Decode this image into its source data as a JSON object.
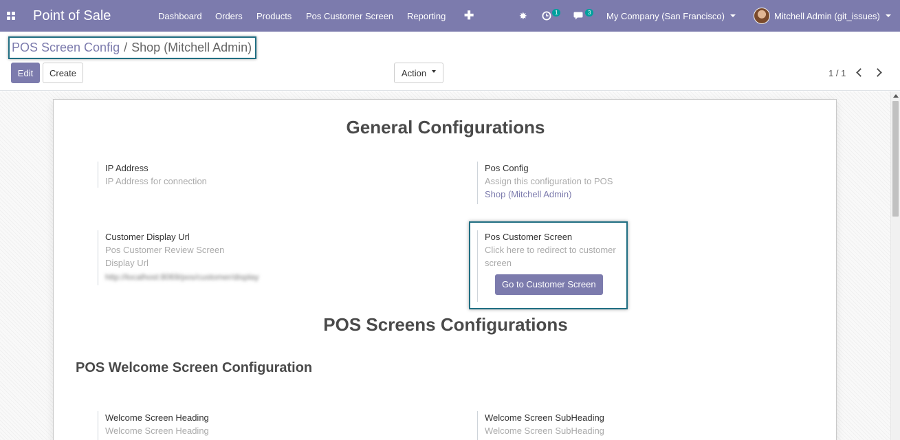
{
  "navbar": {
    "app_title": "Point of Sale",
    "menu": [
      "Dashboard",
      "Orders",
      "Products",
      "Pos Customer Screen",
      "Reporting"
    ],
    "plus_glyph": "✚",
    "bug_glyph": "✸",
    "activity_count": "1",
    "messages_count": "3",
    "company": "My Company (San Francisco)",
    "user": "Mitchell Admin (git_issues)"
  },
  "breadcrumb": {
    "parent": "POS Screen Config",
    "separator": "/",
    "current": "Shop (Mitchell Admin)"
  },
  "toolbar": {
    "edit_label": "Edit",
    "create_label": "Create",
    "action_label": "Action",
    "pager": "1 / 1"
  },
  "form": {
    "general_title": "General Configurations",
    "ip": {
      "label": "IP Address",
      "help": "IP Address for connection"
    },
    "pos_config": {
      "label": "Pos Config",
      "help": "Assign this configuration to POS",
      "value": "Shop (Mitchell Admin)"
    },
    "display_url": {
      "label": "Customer Display Url",
      "help1": "Pos Customer Review Screen",
      "help2": "Display Url",
      "value": "http://localhost:8069/pos/customer/display"
    },
    "customer_screen": {
      "label": "Pos Customer Screen",
      "help": "Click here to redirect to customer screen",
      "button_label": "Go to Customer Screen"
    },
    "screens_title": "POS Screens Configurations",
    "welcome_title": "POS Welcome Screen Configuration",
    "welcome_heading": {
      "label": "Welcome Screen Heading",
      "placeholder": "Welcome Screen Heading"
    },
    "welcome_subheading": {
      "label": "Welcome Screen SubHeading",
      "placeholder": "Welcome Screen SubHeading"
    }
  },
  "colors": {
    "brand": "#7c7bad",
    "highlight_border": "#1f6e82",
    "badge": "#00a09d"
  }
}
